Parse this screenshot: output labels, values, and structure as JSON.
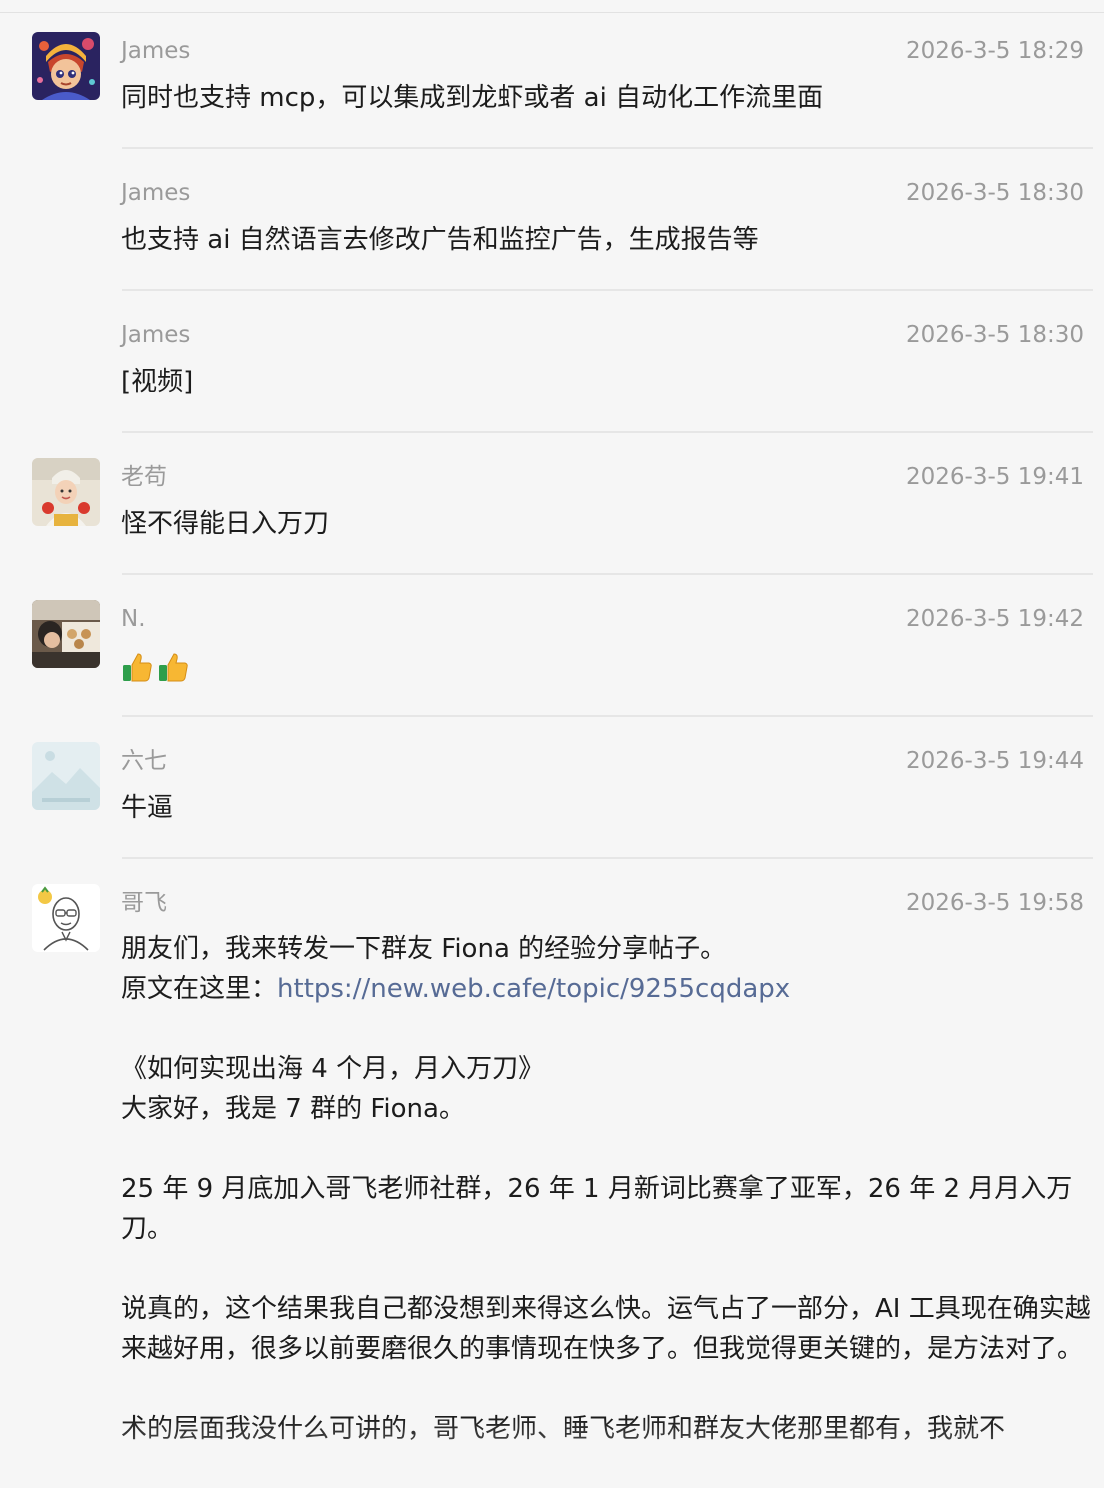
{
  "messages": [
    {
      "sender": "James",
      "time": "2026-3-5 18:29",
      "text": "同时也支持 mcp，可以集成到龙虾或者 ai 自动化工作流里面",
      "avatar": "cartoon-portrait-avatar"
    },
    {
      "sender": "James",
      "time": "2026-3-5 18:30",
      "text": "也支持 ai 自然语言去修改广告和监控广告，生成报告等"
    },
    {
      "sender": "James",
      "time": "2026-3-5 18:30",
      "text": "[视频]"
    },
    {
      "sender": "老苟",
      "time": "2026-3-5 19:41",
      "text": "怪不得能日入万刀",
      "avatar": "child-photo-avatar"
    },
    {
      "sender": "N.",
      "time": "2026-3-5 19:42",
      "emoji": [
        "thumbs-up-icon",
        "thumbs-up-icon"
      ],
      "avatar": "cafe-photo-avatar"
    },
    {
      "sender": "六七",
      "time": "2026-3-5 19:44",
      "text": "牛逼",
      "avatar": "image-placeholder-avatar"
    },
    {
      "sender": "哥飞",
      "time": "2026-3-5 19:58",
      "avatar": "line-drawing-man-avatar",
      "line1": "朋友们，我来转发一下群友 Fiona 的经验分享帖子。",
      "line2_prefix": "原文在这里：",
      "line2_link": "https://new.web.cafe/topic/9255cqdapx",
      "title": "《如何实现出海 4 个月，月入万刀》",
      "intro": "大家好，我是 7 群的 Fiona。",
      "para1": "25 年 9 月底加入哥飞老师社群，26 年 1 月新词比赛拿了亚军，26 年 2 月月入万刀。",
      "para2": "说真的，这个结果我自己都没想到来得这么快。运气占了一部分，AI 工具现在确实越来越好用，很多以前要磨很久的事情现在快多了。但我觉得更关键的，是方法对了。",
      "para3": "术的层面我没什么可讲的，哥飞老师、睡飞老师和群友大佬那里都有，我就不"
    }
  ],
  "colors": {
    "background": "#f6f6f6",
    "meta_text": "#9a9a9a",
    "body_text": "#1c1c1c",
    "link": "#576b95",
    "separator": "#e6e6e6"
  }
}
